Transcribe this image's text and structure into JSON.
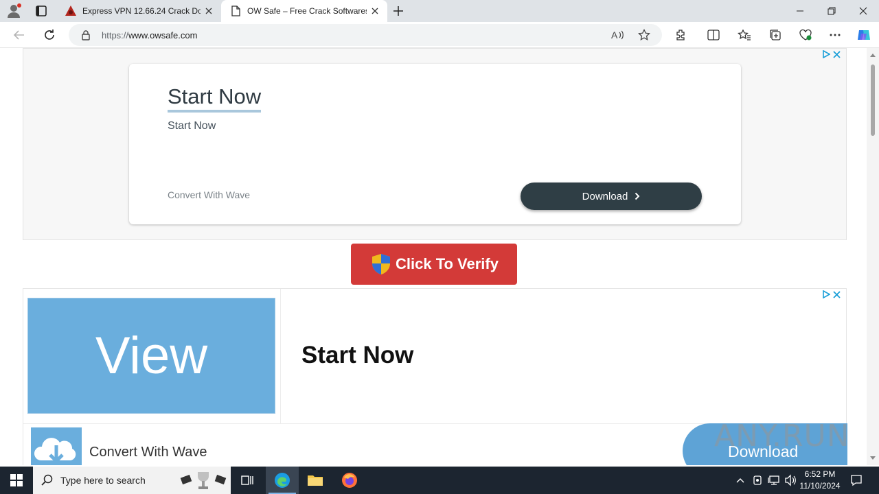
{
  "browser": {
    "tabs": [
      {
        "title": "Express VPN 12.66.24 Crack Down",
        "active": false
      },
      {
        "title": "OW Safe – Free Crack Softwares -",
        "active": true
      }
    ],
    "address": {
      "scheme": "https://",
      "host": "www.owsafe.com"
    }
  },
  "page": {
    "ad_top": {
      "headline": "Start Now",
      "subline": "Start Now",
      "brand": "Convert With Wave",
      "button_label": "Download"
    },
    "verify_button": {
      "label": "Click To Verify"
    },
    "ad_bottom": {
      "image_text": "View",
      "headline": "Start Now",
      "brand": "Convert With Wave",
      "button_label": "Download"
    },
    "watermark": "ANY.RUN"
  },
  "taskbar": {
    "search_placeholder": "Type here to search",
    "time": "6:52 PM",
    "date": "11/10/2024"
  },
  "colors": {
    "verify_red": "#d33a38",
    "ad_blue": "#6aaedd",
    "download_dark": "#2f3e45",
    "taskbar": "#1c2530"
  }
}
